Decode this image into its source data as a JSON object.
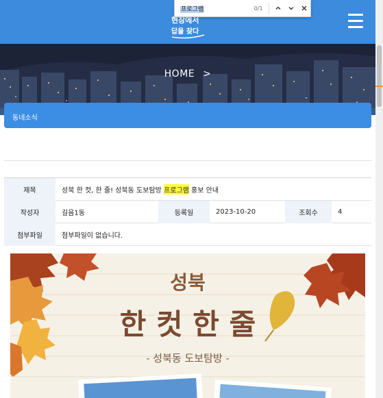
{
  "findbar": {
    "query": "프로그램",
    "count": "0/1",
    "prev_icon": "chevron-up-icon",
    "next_icon": "chevron-down-icon",
    "close_icon": "close-icon"
  },
  "header": {
    "logo_line1": "현장에서",
    "logo_line2": "답을 찾다",
    "menu_icon": "hamburger-icon",
    "color": "#3d8bdc"
  },
  "banner": {
    "title": "HOME",
    "arrow": ">"
  },
  "section": {
    "title": "동네소식",
    "color": "#3b8ee3"
  },
  "post": {
    "title_label": "제목",
    "title_before": "성북 한 컷, 한 줄! 성북동 도보탐방 ",
    "title_highlight": "프로그램",
    "title_after": " 홍보 안내",
    "author_label": "작성자",
    "author": "길음1동",
    "date_label": "등록일",
    "date": "2023-10-20",
    "views_label": "조회수",
    "views": "4",
    "attach_label": "첨부파일",
    "attach": "첨부파일이 없습니다."
  },
  "poster": {
    "line1": "성북",
    "line2": "한 컷 한 줄",
    "line3": "- 성북동 도보탐방 -"
  }
}
